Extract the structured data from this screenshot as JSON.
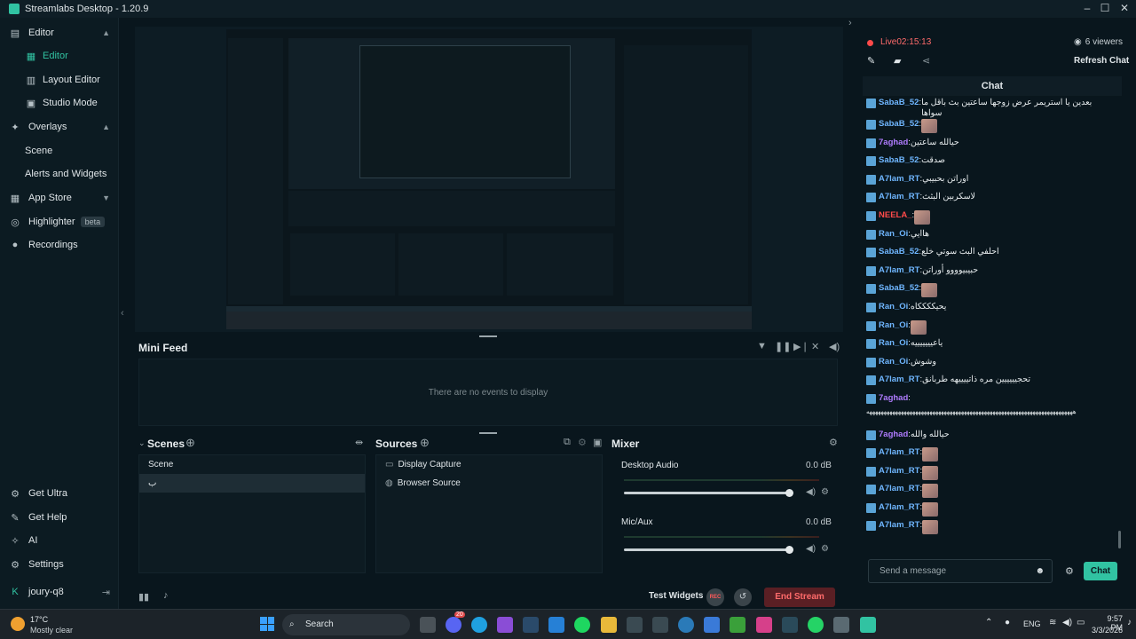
{
  "app": {
    "title": "Streamlabs Desktop - 1.20.9"
  },
  "sidebar": {
    "items": [
      {
        "label": "Editor",
        "icon": "editor-icon"
      },
      {
        "label": "Editor",
        "icon": "editor-sub-icon"
      },
      {
        "label": "Layout Editor"
      },
      {
        "label": "Studio Mode"
      },
      {
        "label": "Overlays",
        "icon": "overlays-icon"
      },
      {
        "label": "Scene"
      },
      {
        "label": "Alerts and Widgets"
      },
      {
        "label": "App Store",
        "icon": "app-store-icon"
      },
      {
        "label": "Highlighter",
        "badge": "beta",
        "icon": "highlighter-icon"
      },
      {
        "label": "Recordings",
        "icon": "recordings-icon"
      }
    ],
    "bottom": [
      {
        "label": "Get Ultra"
      },
      {
        "label": "Get Help"
      },
      {
        "label": "AI"
      },
      {
        "label": "Settings"
      },
      {
        "label": "joury-q8"
      }
    ]
  },
  "minifeed": {
    "title": "Mini Feed",
    "empty": "There are no events to display"
  },
  "scenes": {
    "title": "Scenes",
    "items": [
      "Scene",
      "ب"
    ]
  },
  "sources": {
    "title": "Sources",
    "items": [
      "Display Capture",
      "Browser Source"
    ]
  },
  "mixer": {
    "title": "Mixer",
    "channels": [
      {
        "name": "Desktop Audio",
        "db": "0.0 dB",
        "level": 0.98
      },
      {
        "name": "Mic/Aux",
        "db": "0.0 dB",
        "level": 0.98
      }
    ]
  },
  "footer": {
    "test_widgets": "Test Widgets",
    "rec": "REC",
    "end_stream": "End Stream"
  },
  "live": {
    "status": "Live",
    "time": "02:15:13",
    "viewers": "6 viewers",
    "refresh": "Refresh Chat"
  },
  "chat": {
    "title": "Chat",
    "messages": [
      {
        "name": "SabaB_52",
        "text": "بعدين يا استريمر عرض زوجها ساعتين بث باقل ما سواها",
        "color": "#6fb6ff"
      },
      {
        "name": "SabaB_52",
        "text": "",
        "emote": true,
        "color": "#6fb6ff"
      },
      {
        "name": "7aghad",
        "text": "حيالله ساعتين",
        "color": "#b07cff"
      },
      {
        "name": "SabaB_52",
        "text": "صدقت",
        "color": "#6fb6ff"
      },
      {
        "name": "A7lam_RT",
        "text": "اوراتن بحبيبي",
        "color": "#6fb6ff"
      },
      {
        "name": "A7lam_RT",
        "text": "لاسكربين البثث",
        "color": "#6fb6ff"
      },
      {
        "name": "NEELA_",
        "text": "",
        "emote": true,
        "color": "#ff4a4a"
      },
      {
        "name": "Ran_Oi",
        "text": "هاايي",
        "color": "#6fb6ff"
      },
      {
        "name": "SabaB_52",
        "text": "احلفي البث سوتي خلع",
        "color": "#6fb6ff"
      },
      {
        "name": "A7lam_RT",
        "text": "حبيبيوووو أوراتن",
        "color": "#6fb6ff"
      },
      {
        "name": "SabaB_52",
        "text": "",
        "emote": true,
        "color": "#6fb6ff"
      },
      {
        "name": "Ran_Oi",
        "text": "يحيككككاه",
        "color": "#6fb6ff"
      },
      {
        "name": "Ran_Oi",
        "text": "",
        "emote": true,
        "color": "#6fb6ff"
      },
      {
        "name": "Ran_Oi",
        "text": "ياعيييييييه",
        "color": "#6fb6ff"
      },
      {
        "name": "Ran_Oi",
        "text": "وشوش",
        "color": "#6fb6ff"
      },
      {
        "name": "A7lam_RT",
        "text": "تحجيييييين مره ذاتييييهه طربانق",
        "color": "#6fb6ff"
      },
      {
        "name": "7aghad",
        "text": "",
        "color": "#b07cff",
        "long": "ههههههههههههههههههههههههههههههههههههههههههههههههههههههههههههههههههههههههه"
      },
      {
        "name": "7aghad",
        "text": "حيالله والله",
        "color": "#b07cff"
      },
      {
        "name": "A7lam_RT",
        "text": "",
        "emote": true,
        "color": "#6fb6ff"
      },
      {
        "name": "A7lam_RT",
        "text": "",
        "emote": true,
        "color": "#6fb6ff"
      },
      {
        "name": "A7lam_RT",
        "text": "",
        "emote": true,
        "color": "#6fb6ff"
      },
      {
        "name": "A7lam_RT",
        "text": "",
        "emote": true,
        "color": "#6fb6ff"
      },
      {
        "name": "A7lam_RT",
        "text": "",
        "emote": true,
        "color": "#6fb6ff"
      }
    ],
    "input_placeholder": "Send a message",
    "send": "Chat"
  },
  "taskbar": {
    "weather_temp": "17°C",
    "weather_text": "Mostly clear",
    "search": "Search",
    "lang": "ENG",
    "time": "9:57 PM",
    "date": "3/3/2026",
    "chat_badge": "20"
  }
}
